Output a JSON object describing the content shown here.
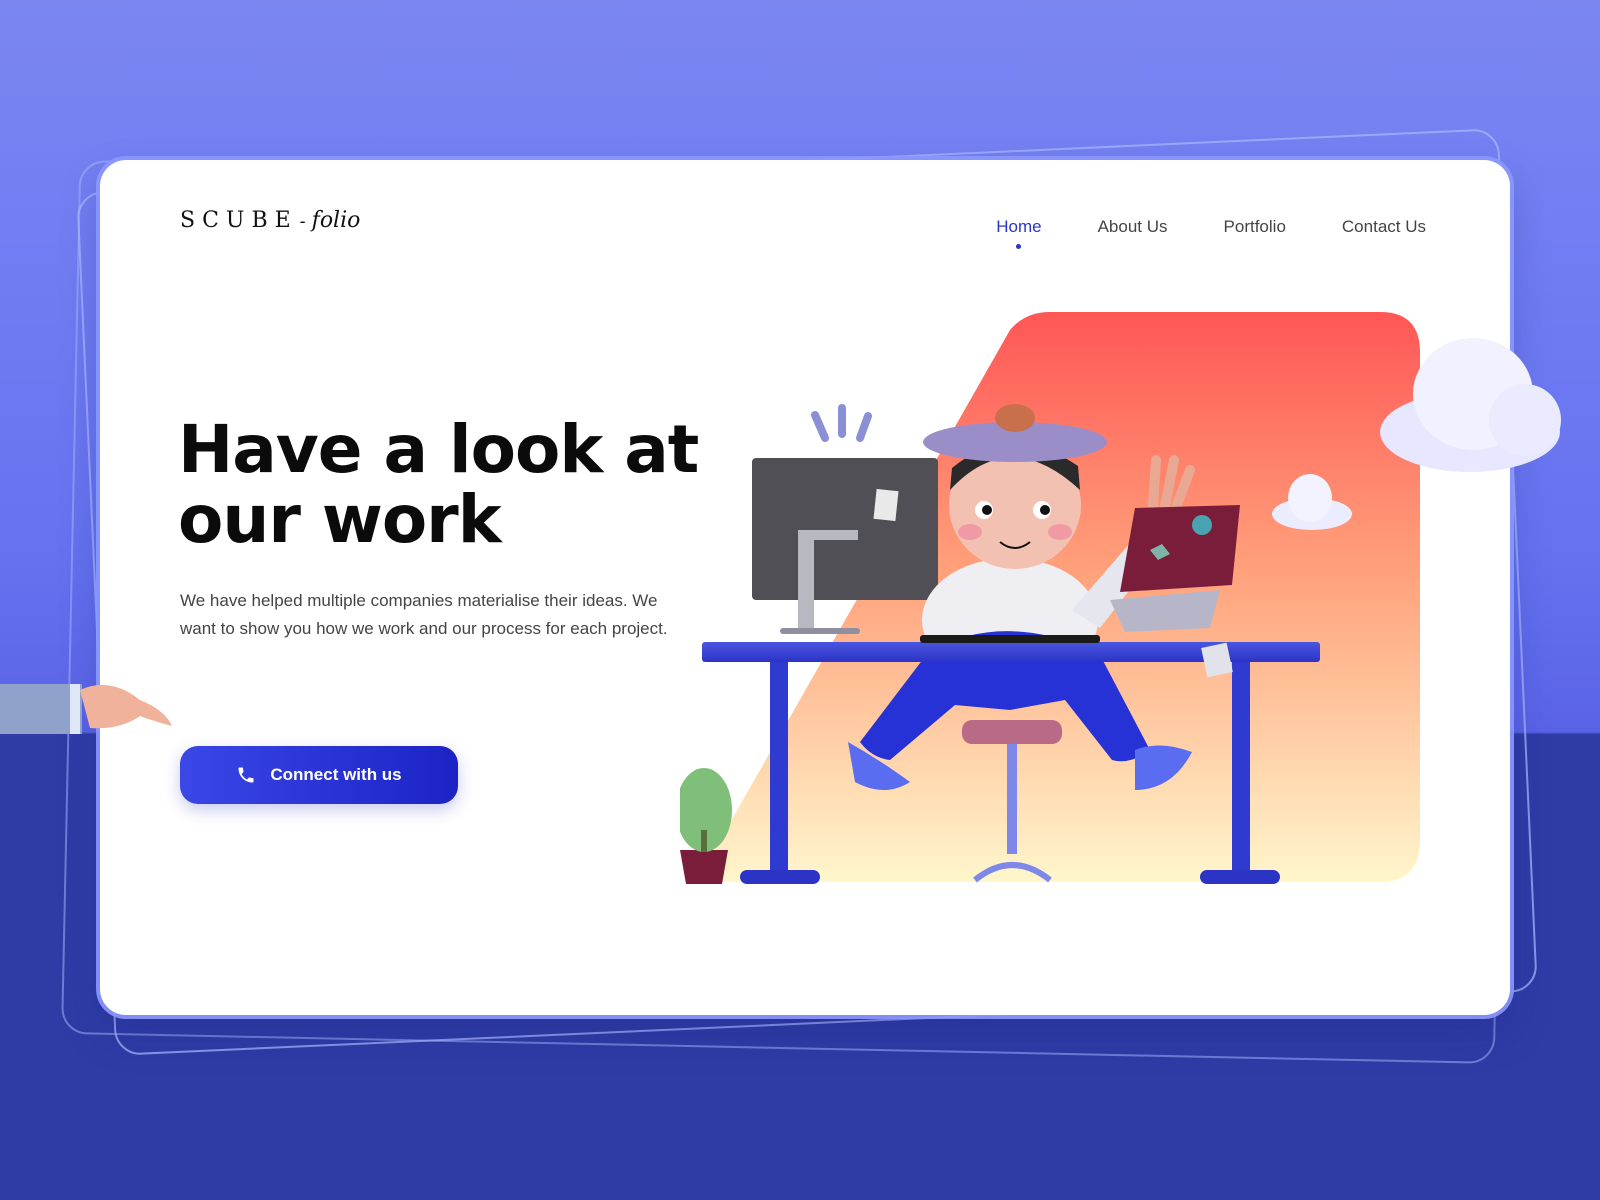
{
  "brand": {
    "name": "SCUBE",
    "separator": "-",
    "script": "folio"
  },
  "nav": {
    "items": [
      {
        "label": "Home",
        "active": true
      },
      {
        "label": "About Us",
        "active": false
      },
      {
        "label": "Portfolio",
        "active": false
      },
      {
        "label": "Contact Us",
        "active": false
      }
    ]
  },
  "hero": {
    "headline_line1": "Have a look at",
    "headline_line2": "our work",
    "description": "We have helped multiple companies materialise their ideas. We want to show you how we work and our process for each project.",
    "cta_label": "Connect with us",
    "cta_icon": "phone-icon"
  },
  "colors": {
    "accent": "#2b36c9",
    "background_top": "#7b86f3",
    "background_bottom": "#2f3ca6",
    "hero_gradient_top": "#ff5656",
    "hero_gradient_bottom": "#fff6cc"
  }
}
